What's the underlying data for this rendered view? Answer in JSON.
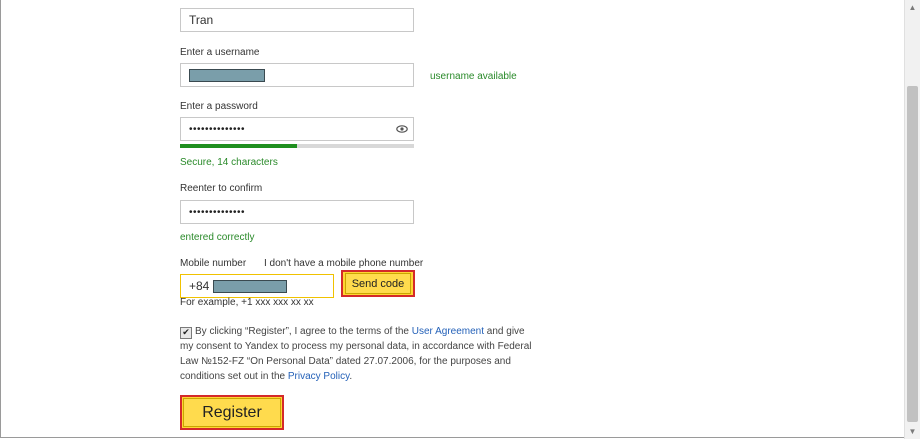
{
  "form": {
    "last_name_value": "Tran",
    "username_label": "Enter a username",
    "username_status": "username available",
    "password_label": "Enter a password",
    "password_dots": "••••••••••••••",
    "password_strength_pct": 50,
    "password_strength_text": "Secure, 14 characters",
    "confirm_label": "Reenter to confirm",
    "confirm_dots": "••••••••••••••",
    "confirm_status": "entered correctly",
    "mobile_label": "Mobile number",
    "no_phone_link": "I don't have a mobile phone number",
    "phone_prefix": "+84",
    "send_code_label": "Send code",
    "phone_example": "For example, +1 xxx xxx xx xx",
    "agree_part1": "By clicking “Register”, I agree to the terms of the ",
    "agree_link1": "User Agreement",
    "agree_part2": " and give my consent to Yandex to process my personal data, in accordance with Federal Law №152-FZ “On Personal Data” dated 27.07.2006, for the purposes and conditions set out in the ",
    "agree_link2": "Privacy Policy",
    "agree_part3": ".",
    "register_label": "Register",
    "checkbox_mark": "✔"
  },
  "colors": {
    "accent_yellow": "#ffdb4d",
    "highlight_red": "#d42a2a",
    "success_green": "#2a8a2a",
    "link_blue": "#2461b8"
  }
}
